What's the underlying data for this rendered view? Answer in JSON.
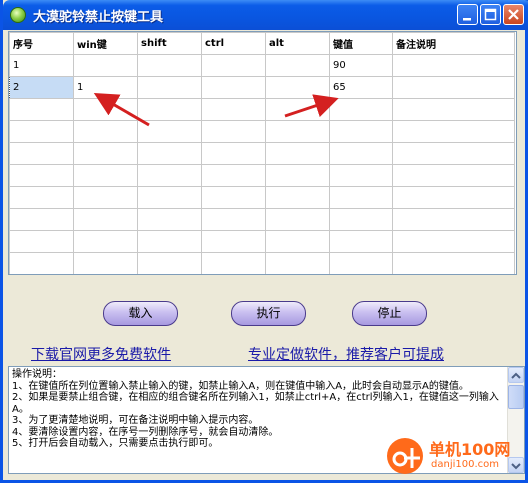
{
  "window": {
    "title": "大漠驼铃禁止按键工具"
  },
  "grid": {
    "headers": [
      "序号",
      "win键",
      "shift",
      "ctrl",
      "alt",
      "键值",
      "备注说明"
    ],
    "rows": [
      [
        "1",
        "",
        "",
        "",
        "",
        "90",
        ""
      ],
      [
        "2",
        "1",
        "",
        "",
        "",
        "65",
        ""
      ]
    ],
    "empty_row_count": 9
  },
  "buttons": {
    "load": "载入",
    "run": "执行",
    "stop": "停止"
  },
  "links": {
    "free_software": "下载官网更多免费软件",
    "custom": "专业定做软件，推荐客户可提成"
  },
  "instructions": {
    "lines": [
      "操作说明：",
      "1、在键值所在列位置输入禁止输入的键，如禁止输入A，则在键值中输入A，此时会自动显示A的键值。",
      "2、如果是要禁止组合键，在相应的组合键名所在列输入1，如禁止ctrl+A，在ctrl列输入1，在键值这一列输入A。",
      "3、为了更清楚地说明，可在备注说明中输入提示内容。",
      "4、要清除设置内容，在序号一列删除序号，就会自动清除。",
      "5、打开后会自动载入，只需要点击执行即可。"
    ]
  },
  "watermark": {
    "brand": "单机100网",
    "domain": "danji100.com"
  },
  "colors": {
    "arrow": "#d42020",
    "title_bar": "#0b5ce8",
    "button": "#b7abe8",
    "link": "#1a1aa8"
  }
}
